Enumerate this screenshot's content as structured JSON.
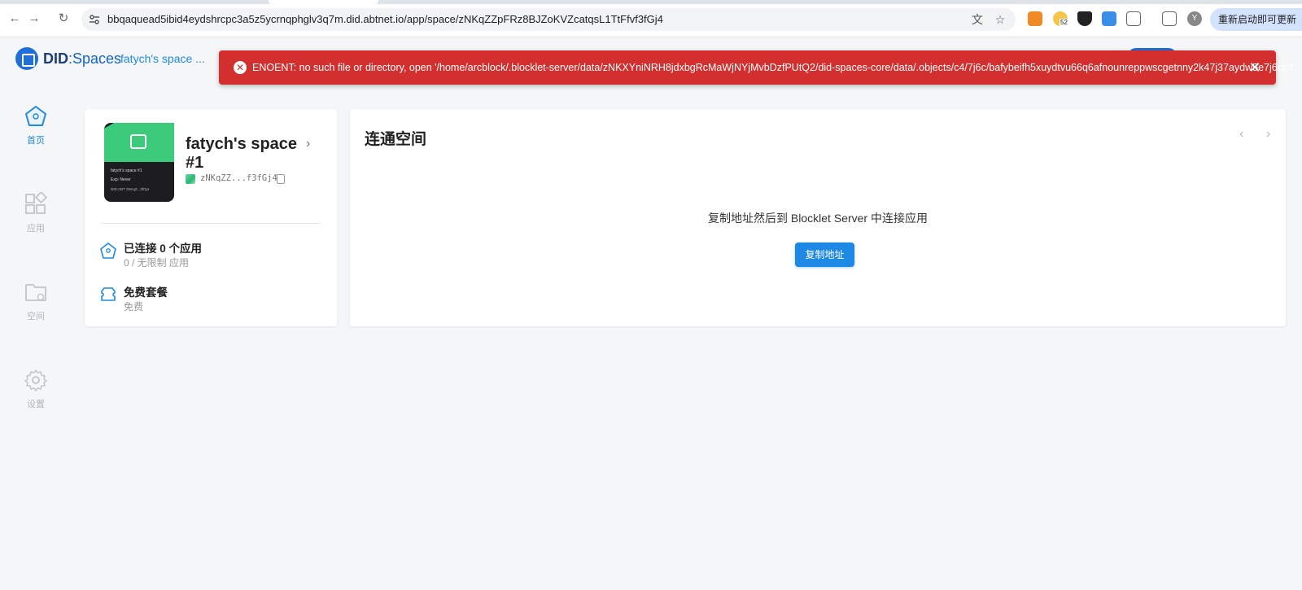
{
  "browser": {
    "url": "bbqaquead5ibid4eydshrcpc3a5z5ycrnqphglv3q7m.did.abtnet.io/app/space/zNKqZZpFRz8BJZoKVZcatqsL1TtFfvf3fGj4",
    "back_icon": "←",
    "forward_icon": "→",
    "reload_icon": "↻",
    "translate_icon": "文",
    "bookmark_icon": "☆",
    "extension_badge": "52",
    "profile_initial": "Y",
    "update_label": "重新启动即可更新"
  },
  "header": {
    "brand_prefix": "DID",
    "brand_suffix": ":Spaces",
    "space_switcher": "fatych's space ..."
  },
  "error_toast": {
    "message": "ENOENT: no such file or directory, open '/home/arcblock/.blocklet-server/data/zNKXYniNRH8jdxbgRcMaWjNYjMvbDzfPUtQ2/did-spaces-core/data/.objects/c4/7j6c/bafybeifh5xuydtvu66q6afnounreppwscgetnny2k47j37aydw5e7j6cc4'",
    "close_icon": "✕",
    "error_icon": "✕"
  },
  "sidebar": {
    "items": [
      {
        "label": "首页",
        "icon": "home-icon",
        "active": true
      },
      {
        "label": "应用",
        "icon": "apps-icon",
        "active": false
      },
      {
        "label": "空间",
        "icon": "folder-icon",
        "active": false
      },
      {
        "label": "设置",
        "icon": "gear-icon",
        "active": false
      }
    ]
  },
  "space_card": {
    "title": "fatych's space #1",
    "did_short": "zNKqZZ...f3fGj4",
    "nft_name": "fatych's space #1",
    "nft_exp": "Exp: Never",
    "nft_did": "DID:ABT zNKqZ...3fGj4",
    "apps_connected": "已连接 0 个应用",
    "apps_limit": "0 / 无限制 应用",
    "plan_title": "免费套餐",
    "plan_sub": "免费"
  },
  "connect_card": {
    "title": "连通空间",
    "hint": "复制地址然后到 Blocklet Server 中连接应用",
    "copy_button": "复制地址",
    "prev_icon": "‹",
    "next_icon": "›"
  },
  "colors": {
    "primary": "#1e88e5",
    "error": "#d32f2f",
    "nft_green": "#3ccb7a"
  }
}
